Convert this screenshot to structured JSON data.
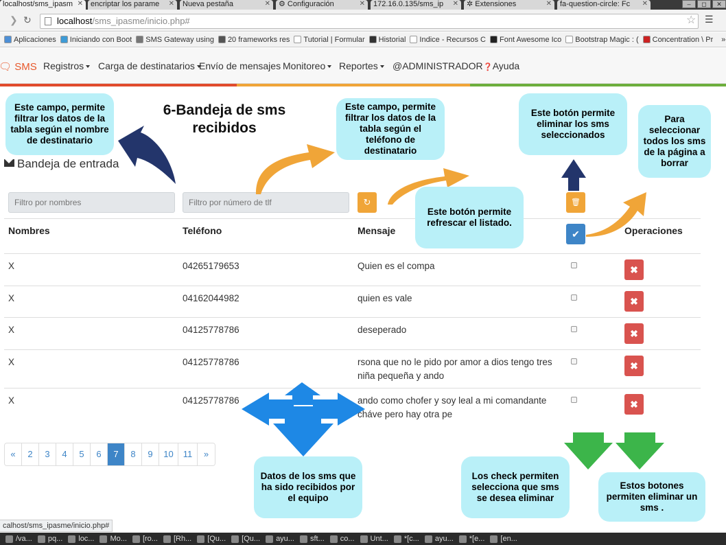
{
  "browser": {
    "tabs": [
      {
        "label": "localhost/sms_ipasm",
        "active": true
      },
      {
        "label": "encriptar los parame"
      },
      {
        "label": "Nueva pestaña"
      },
      {
        "label": "Configuración"
      },
      {
        "label": "172.16.0.135/sms_ip"
      },
      {
        "label": "Extensiones"
      },
      {
        "label": "fa-question-circle: Fc"
      }
    ],
    "address": {
      "host": "localhost",
      "path": "/sms_ipasme/inicio.php#"
    },
    "bookmarks": [
      {
        "label": "Aplicaciones",
        "color": "#4d8fd6"
      },
      {
        "label": "Iniciando con Boot",
        "color": "#3e9bd6"
      },
      {
        "label": "SMS Gateway using",
        "color": "#777777"
      },
      {
        "label": "20 frameworks res",
        "color": "#555555"
      },
      {
        "label": "Tutorial | Formular",
        "color": "#ffffff"
      },
      {
        "label": "Historial",
        "color": "#333333"
      },
      {
        "label": "Indice - Recursos C",
        "color": "#ffffff"
      },
      {
        "label": "Font Awesome Ico",
        "color": "#222222"
      },
      {
        "label": "Bootstrap Magic : (",
        "color": "#ffffff"
      },
      {
        "label": "Concentration \\ Pr",
        "color": "#cc2222"
      }
    ],
    "more_bookmarks": "»",
    "status_url": "calhost/sms_ipasme/inicio.php#"
  },
  "navbar": {
    "brand": "SMS",
    "items": [
      {
        "label": "Registros",
        "dropdown": true
      },
      {
        "label": "Carga de destinatarios",
        "dropdown": true
      },
      {
        "label": "Envío de mensajes",
        "dropdown": false
      },
      {
        "label": "Monitoreo",
        "dropdown": true
      },
      {
        "label": "Reportes",
        "dropdown": true
      },
      {
        "label": "@ADMINISTRADOR",
        "dropdown": false
      },
      {
        "label": "Ayuda",
        "dropdown": false
      }
    ],
    "help_glyph": "❓"
  },
  "page": {
    "big_title": "6-Bandeja de sms recibidos",
    "section_title": "Bandeja de entrada",
    "filter_names_placeholder": "Filtro por nombres",
    "filter_phone_placeholder": "Filtro por número de tlf",
    "refresh_glyph": "↻",
    "trash_glyph": "🗑",
    "check_glyph": "✔",
    "delete_glyph": "✖"
  },
  "table": {
    "headers": [
      "Nombres",
      "Teléfono",
      "Mensaje",
      "Operaciones"
    ],
    "rows": [
      {
        "name": "X",
        "phone": "04265179653",
        "message": "Quien es el compa"
      },
      {
        "name": "X",
        "phone": "04162044982",
        "message": "quien es vale"
      },
      {
        "name": "X",
        "phone": "04125778786",
        "message": "deseperado"
      },
      {
        "name": "X",
        "phone": "04125778786",
        "message": "rsona que no le pido por amor a dios tengo tres niña pequeña y ando"
      },
      {
        "name": "X",
        "phone": "04125778786",
        "message": "ando como chofer y soy leal a mi comandante cháve pero hay otra pe"
      }
    ]
  },
  "pagination": {
    "prev": "«",
    "pages": [
      "2",
      "3",
      "4",
      "5",
      "6",
      "7",
      "8",
      "9",
      "10",
      "11"
    ],
    "active_page": "7",
    "next": "»"
  },
  "annotations": {
    "filter_names": "Este campo, permite filtrar los datos de la tabla según el nombre de destinatario",
    "filter_phone": "Este campo, permite filtrar los datos de la tabla según el teléfono de destinatario",
    "delete_selected": "Este botón permite eliminar los sms seleccionados",
    "select_all": "Para seleccionar todos los sms de la página a borrar",
    "refresh": "Este botón permite refrescar el listado.",
    "received_data": "Datos de los sms que ha sido recibidos por el equipo",
    "checks": "Los check permiten selecciona que sms se desea eliminar",
    "delete_buttons": "Estos botones permiten eliminar un sms ."
  },
  "taskbar": {
    "items": [
      "/va...",
      "pq...",
      "loc...",
      "Mo...",
      "[ro...",
      "[Rh...",
      "[Qu...",
      "[Qu...",
      "ayu...",
      "sft...",
      "co...",
      "Unt...",
      "*[c...",
      "ayu...",
      "*[e...",
      "[en..."
    ]
  },
  "colors": {
    "brand": "#e7582b",
    "callout": "#b9f0f8",
    "primary": "#3e85c7",
    "warning": "#f0a538",
    "danger": "#d9534f",
    "arrow_orange": "#f0a538",
    "arrow_navy": "#23356b",
    "arrow_green": "#3cb54a",
    "arrow_blue": "#1e88e5"
  }
}
